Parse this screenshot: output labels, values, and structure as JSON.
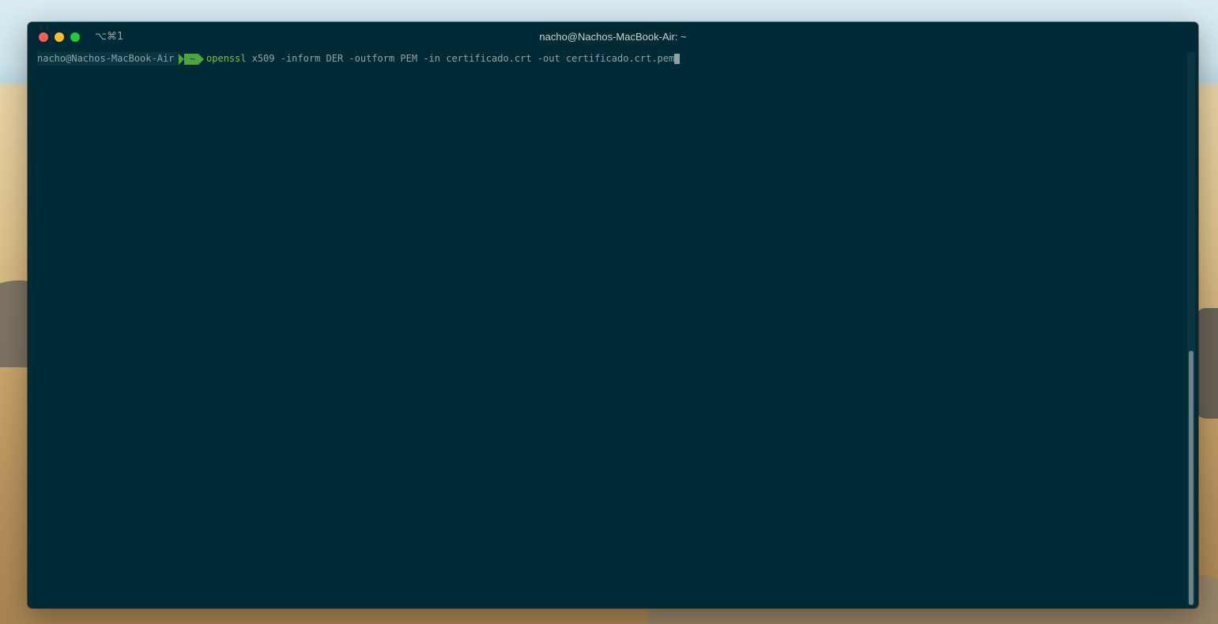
{
  "window": {
    "title": "nacho@Nachos-MacBook-Air: ~",
    "shortcut": "⌥⌘1"
  },
  "prompt": {
    "host": "nacho@Nachos-MacBook-Air",
    "dir": "~"
  },
  "command": {
    "name": "openssl",
    "args": "x509 -inform DER -outform PEM -in certificado.crt -out certificado.crt.pem"
  },
  "scrollbar": {
    "thumb_fraction_start": 0.54
  },
  "colors": {
    "terminal_bg": "#002b36",
    "prompt_host_bg": "#073642",
    "prompt_dir_bg": "#4ba53a",
    "command_name": "#85c02a",
    "text": "#93a1a1"
  },
  "icons": [
    "close-icon",
    "minimize-icon",
    "maximize-icon"
  ]
}
